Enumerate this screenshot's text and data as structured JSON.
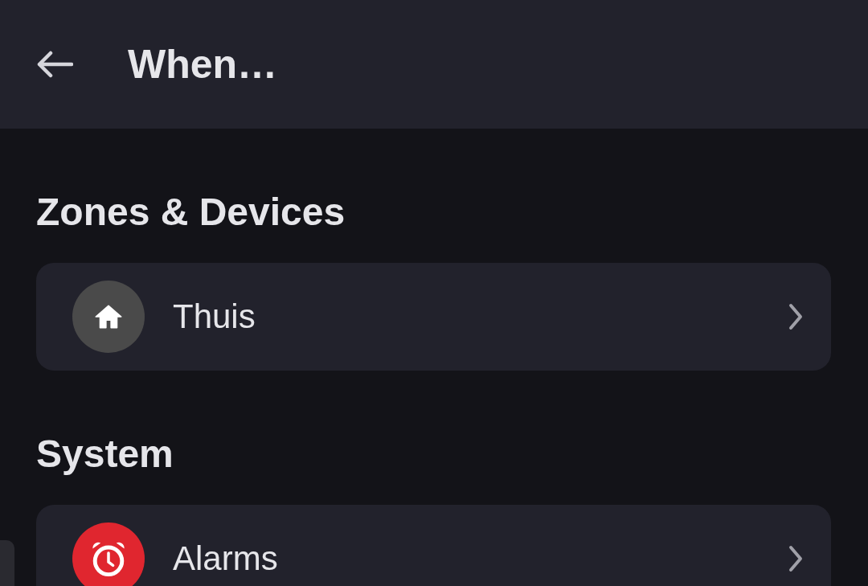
{
  "header": {
    "title": "When…"
  },
  "sections": [
    {
      "title": "Zones & Devices",
      "items": [
        {
          "label": "Thuis",
          "kind": "home",
          "color": "#4a4a4a"
        }
      ]
    },
    {
      "title": "System",
      "items": [
        {
          "label": "Alarms",
          "kind": "alarm",
          "color": "#e0262f"
        }
      ]
    }
  ]
}
